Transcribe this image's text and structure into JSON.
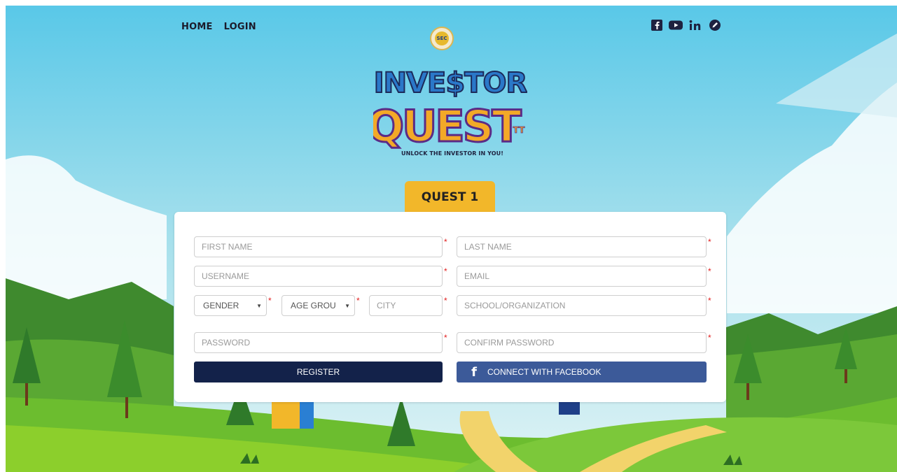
{
  "nav": {
    "home": "HOME",
    "login": "LOGIN"
  },
  "social": [
    "facebook-icon",
    "youtube-icon",
    "linkedin-icon",
    "blog-icon"
  ],
  "logo": {
    "seal_text": "SEC",
    "line1": "INVE$TOR",
    "line2": "QUEST",
    "suffix": "TT"
  },
  "tagline": "UNLOCK THE INVESTOR IN YOU!",
  "quest_tab": "QUEST 1",
  "form": {
    "first_name": {
      "placeholder": "FIRST NAME",
      "value": ""
    },
    "last_name": {
      "placeholder": "LAST NAME",
      "value": ""
    },
    "username": {
      "placeholder": "USERNAME",
      "value": ""
    },
    "email": {
      "placeholder": "EMAIL",
      "value": ""
    },
    "gender": {
      "selected": "GENDER"
    },
    "age_group": {
      "selected": "AGE GROU"
    },
    "city": {
      "placeholder": "CITY",
      "value": ""
    },
    "school": {
      "placeholder": "SCHOOL/ORGANIZATION",
      "value": ""
    },
    "password": {
      "placeholder": "PASSWORD",
      "value": ""
    },
    "confirm_password": {
      "placeholder": "CONFIRM PASSWORD",
      "value": ""
    },
    "required_mark": "*",
    "register_label": "REGISTER",
    "facebook_label": "CONNECT WITH FACEBOOK"
  },
  "colors": {
    "sky": "#8fd7ea",
    "accent_yellow": "#f2b72a",
    "register_bg": "#13224a",
    "facebook_bg": "#3c5a99",
    "required": "#e21f1f"
  }
}
